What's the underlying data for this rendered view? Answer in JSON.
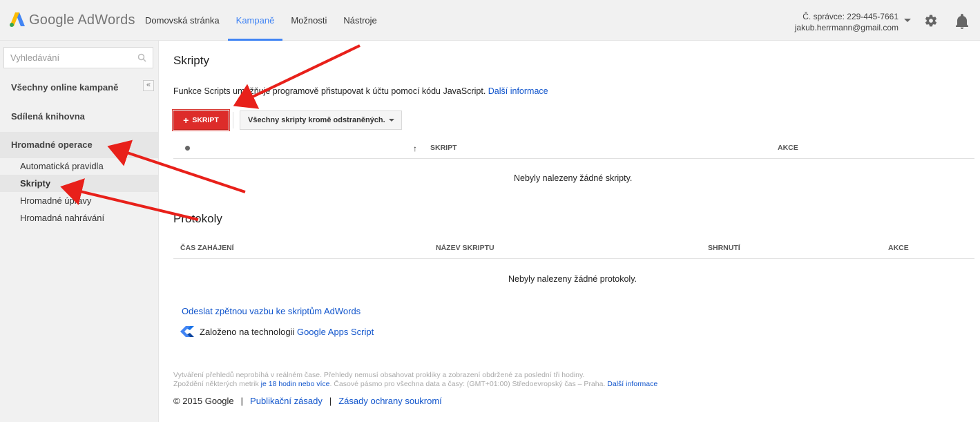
{
  "header": {
    "logo_google": "Google",
    "logo_product": "AdWords",
    "nav": [
      {
        "label": "Domovská stránka",
        "active": false
      },
      {
        "label": "Kampaně",
        "active": true
      },
      {
        "label": "Možnosti",
        "active": false
      },
      {
        "label": "Nástroje",
        "active": false
      }
    ],
    "account_id": "Č. správce: 229-445-7661",
    "account_email": "jakub.herrmann@gmail.com"
  },
  "sidebar": {
    "search_placeholder": "Vyhledávání",
    "items": [
      {
        "label": "Všechny online kampaně"
      },
      {
        "label": "Sdílená knihovna"
      },
      {
        "label": "Hromadné operace"
      }
    ],
    "collapse_label": "«",
    "subitems": [
      {
        "label": "Automatická pravidla",
        "active": false
      },
      {
        "label": "Skripty",
        "active": true
      },
      {
        "label": "Hromadné úpravy",
        "active": false
      },
      {
        "label": "Hromadná nahrávání",
        "active": false
      }
    ]
  },
  "main": {
    "title": "Skripty",
    "intro_text": "Funkce Scripts umožňuje programově přistupovat k účtu pomocí kódu JavaScript.",
    "intro_link": "Další informace",
    "add_button_plus": "+",
    "add_button_label": "SKRIPT",
    "filter_label": "Všechny skripty kromě odstraněných.",
    "scripts_table": {
      "sort_arrow": "↑",
      "columns": [
        "SKRIPT",
        "AKCE"
      ],
      "empty": "Nebyly nalezeny žádné skripty."
    },
    "logs_title": "Protokoly",
    "logs_table": {
      "columns": [
        "ČAS ZAHÁJENÍ",
        "NÁZEV SKRIPTU",
        "SHRNUTÍ",
        "AKCE"
      ],
      "empty": "Nebyly nalezeny žádné protokoly."
    },
    "feedback_link": "Odeslat zpětnou vazbu ke skriptům AdWords",
    "apps_prefix": "Založeno na technologii",
    "apps_link": "Google Apps Script",
    "note_line1": "Vytváření přehledů neprobíhá v reálném čase. Přehledy nemusí obsahovat prokliky a zobrazení obdržené za poslední tři hodiny.",
    "note_line2_prefix": "Zpoždění některých metrik",
    "note_line2_link": "je 18 hodin nebo více",
    "note_line2_suffix": ". Časové pásmo pro všechna data a časy: (GMT+01:00) Středoevropský čas – Praha.",
    "note_line2_link2": "Další informace",
    "copyright": "© 2015 Google",
    "footer_sep": "|",
    "footer_link1": "Publikační zásady",
    "footer_link2": "Zásady ochrany soukromí"
  },
  "colors": {
    "accent_blue": "#4285f4",
    "link": "#1155cc",
    "button_red": "#dd2c2a",
    "annotation_red": "#e8201a"
  }
}
